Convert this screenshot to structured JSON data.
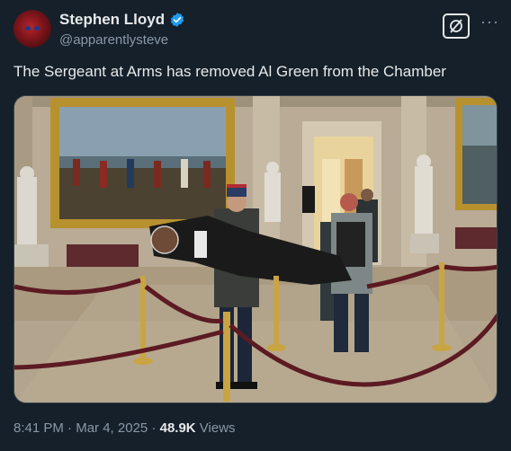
{
  "author": {
    "name": "Stephen Lloyd",
    "handle": "@apparentlysteve",
    "verified": true,
    "avatar_icon": "avatar-red-mask"
  },
  "tweet": {
    "text": "The Sergeant at Arms has removed Al Green from the Chamber"
  },
  "meta": {
    "time": "8:41 PM",
    "separator1": " · ",
    "date": "Mar 4, 2025",
    "separator2": " · ",
    "views_count": "48.9K",
    "views_label": " Views"
  },
  "icons": {
    "grok": "grok-icon",
    "more": "more-options-icon",
    "verified": "verified-badge-icon"
  },
  "colors": {
    "background": "#15202b",
    "text": "#e7e9ea",
    "secondary": "#8b98a5",
    "verified_blue": "#1d9bf0"
  }
}
